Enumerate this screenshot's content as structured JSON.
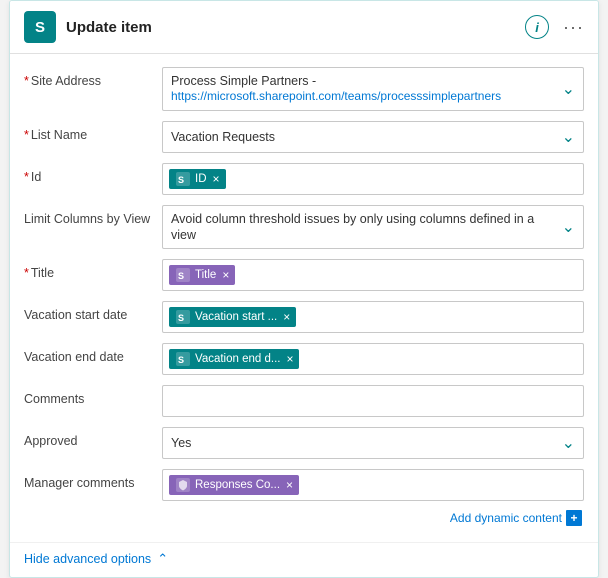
{
  "header": {
    "logo_letter": "S",
    "title": "Update item",
    "info_label": "i",
    "dots_label": "···"
  },
  "form": {
    "fields": [
      {
        "id": "site-address",
        "label": "* Site Address",
        "required": true,
        "type": "dropdown",
        "line1": "Process Simple Partners -",
        "line2": "https://microsoft.sharepoint.com/teams/processsimplepartners"
      },
      {
        "id": "list-name",
        "label": "* List Name",
        "required": true,
        "type": "dropdown",
        "value": "Vacation Requests"
      },
      {
        "id": "id",
        "label": "* Id",
        "required": true,
        "type": "tag",
        "tags": [
          {
            "label": "ID",
            "color": "teal",
            "icon": "sp"
          }
        ]
      },
      {
        "id": "limit-columns",
        "label": "Limit Columns by View",
        "required": false,
        "type": "dropdown",
        "value": "Avoid column threshold issues by only using columns defined in a view"
      },
      {
        "id": "title",
        "label": "* Title",
        "required": true,
        "type": "tag",
        "tags": [
          {
            "label": "Title",
            "color": "purple",
            "icon": "sp-purple"
          }
        ]
      },
      {
        "id": "vacation-start",
        "label": "Vacation start date",
        "required": false,
        "type": "tag",
        "tags": [
          {
            "label": "Vacation start ...",
            "color": "teal",
            "icon": "sp"
          }
        ]
      },
      {
        "id": "vacation-end",
        "label": "Vacation end date",
        "required": false,
        "type": "tag",
        "tags": [
          {
            "label": "Vacation end d...",
            "color": "teal",
            "icon": "sp"
          }
        ]
      },
      {
        "id": "comments",
        "label": "Comments",
        "required": false,
        "type": "empty"
      },
      {
        "id": "approved",
        "label": "Approved",
        "required": false,
        "type": "dropdown",
        "value": "Yes"
      },
      {
        "id": "manager-comments",
        "label": "Manager comments",
        "required": false,
        "type": "tag",
        "tags": [
          {
            "label": "Responses Co...",
            "color": "purple",
            "icon": "sp-shield"
          }
        ]
      }
    ],
    "dynamic_content_label": "Add dynamic content",
    "hide_advanced_label": "Hide advanced options"
  }
}
